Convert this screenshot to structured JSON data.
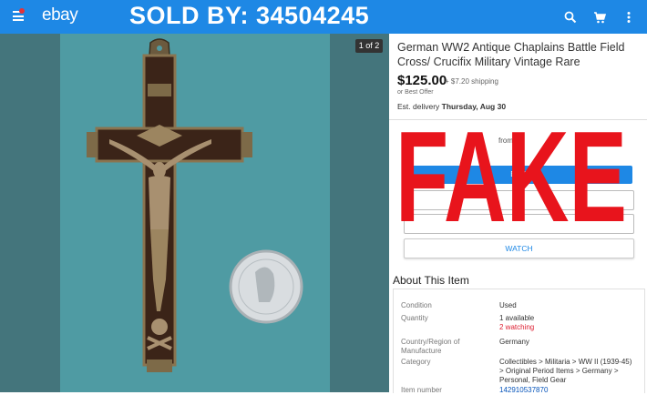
{
  "header": {
    "logo": "ebay",
    "banner": "SOLD BY: 34504245",
    "icons": [
      "menu-icon",
      "search-icon",
      "cart-icon",
      "more-icon"
    ]
  },
  "gallery": {
    "counter": "1 of 2"
  },
  "listing": {
    "title": "German WW2 Antique Chaplains Battle Field Cross/ Crucifix Military Vintage Rare",
    "price": "$125.00",
    "shipping": "+ $7.20 shipping",
    "best_offer": "or Best Offer",
    "delivery_prefix": "Est. delivery",
    "delivery_date": "Thursday, Aug 30",
    "partial_text": "from",
    "buttons": {
      "buy": "BUY",
      "watch": "WATCH"
    }
  },
  "overlay": {
    "text": "FAKE",
    "color": "#e8141c"
  },
  "about": {
    "title": "About This Item",
    "rows": [
      {
        "label": "Condition",
        "value": "Used"
      },
      {
        "label": "Quantity",
        "value": "1 available",
        "value2": "2 watching"
      },
      {
        "label": "Country/Region of Manufacture",
        "value": "Germany"
      },
      {
        "label": "Category",
        "value": "Collectibles > Militaria > WW II (1939-45) > Original Period Items > Germany > Personal, Field Gear"
      },
      {
        "label": "Item number",
        "value": "142910537870"
      }
    ]
  },
  "colors": {
    "header": "#1e88e5",
    "link": "#0654ba",
    "watching": "#dd1e31"
  }
}
